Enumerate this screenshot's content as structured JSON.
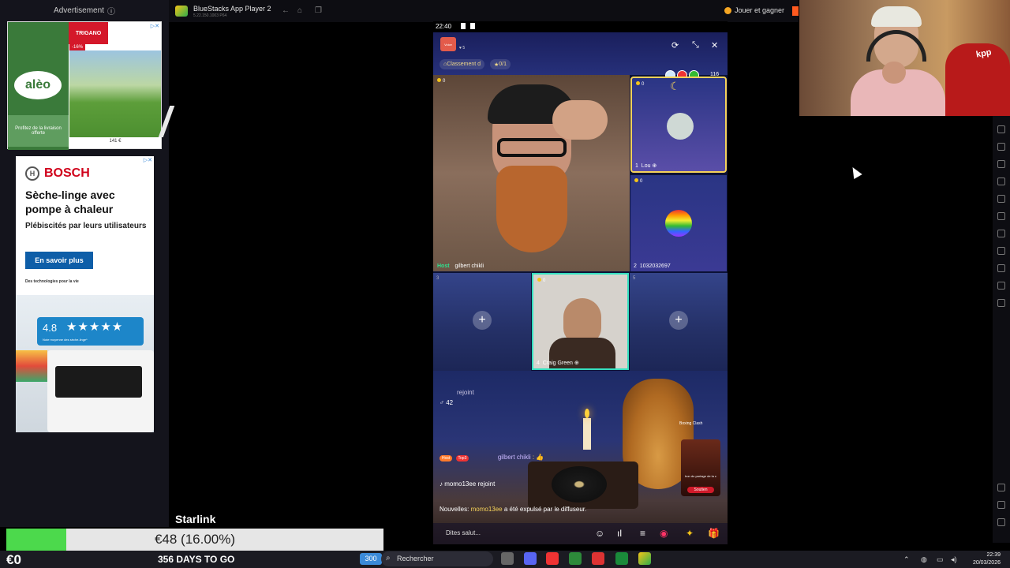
{
  "ads": {
    "header": "Advertisement",
    "trigano": {
      "logo": "TRIGANO",
      "logo_sub": "STORE",
      "brand": "alèo",
      "brand_sub": "BY TRIGANO",
      "promo": "Profitez de la livraison offerte",
      "badge": "-16%",
      "price": "141 €"
    },
    "bosch": {
      "brand": "BOSCH",
      "title": "Sèche-linge avec pompe à chaleur",
      "subtitle": "Plébiscités par leurs utilisateurs",
      "cta": "En savoir plus",
      "tagline": "Des technologies pour la vie",
      "rating": "4.8",
      "stars": "★★★★★",
      "rating_note": "Note moyenne des sèche-linge*"
    }
  },
  "window": {
    "title": "BlueStacks App Player 2",
    "version": "5.22.150.1003  P64",
    "jouer_label": "Jouer et gagner"
  },
  "phone": {
    "status_time": "22:40",
    "room_likes": "5",
    "room_logo": "Voice",
    "pill_rank": "Classement d",
    "pill_gifts": "0/1",
    "viewers": "116",
    "host": {
      "tag": "Host",
      "name": "gilbert chikli",
      "coins": "0"
    },
    "seats": [
      {
        "num": "1",
        "name": "Lou",
        "coins": "0"
      },
      {
        "num": "2",
        "name": "1032032697",
        "coins": "0"
      },
      {
        "num": "3"
      },
      {
        "num": "4",
        "name": "Craig Green",
        "coins": "0"
      },
      {
        "num": "5"
      }
    ],
    "chat": {
      "joined_faded": "rejoint",
      "count_line": "42",
      "host_msg_name": "gilbert chikli",
      "host_msg_text": ": 👍",
      "tag_host": "Host",
      "tag_top": "Top3",
      "join_user": "momo13ee",
      "join_text": "rejoint",
      "news_label": "Nouvelles:",
      "news_user": "momo13ee",
      "news_text": "a été expulsé par le diffuseur."
    },
    "input_placeholder": "Dites salut...",
    "boxing_title": "Boxing Clash",
    "boxing_cta": "Soutien",
    "boxing_caption": "bon du partage de la c"
  },
  "overlay": {
    "starlink": "Starlink",
    "progress_label": "€48 (16.00%)",
    "progress_fraction": 0.16,
    "euro": "€0",
    "days": "356 DAYS TO GO"
  },
  "webcam": {
    "shirt_text": "kpp"
  },
  "taskbar": {
    "search_placeholder": "Rechercher",
    "time": "22:39",
    "date": "20/03/2026",
    "left_badge": "300"
  },
  "colors": {
    "progress_fill": "#4cd94c",
    "bosch_red": "#d0021b",
    "bosch_blue": "#0e5ea8",
    "host_green": "#30e08f"
  }
}
